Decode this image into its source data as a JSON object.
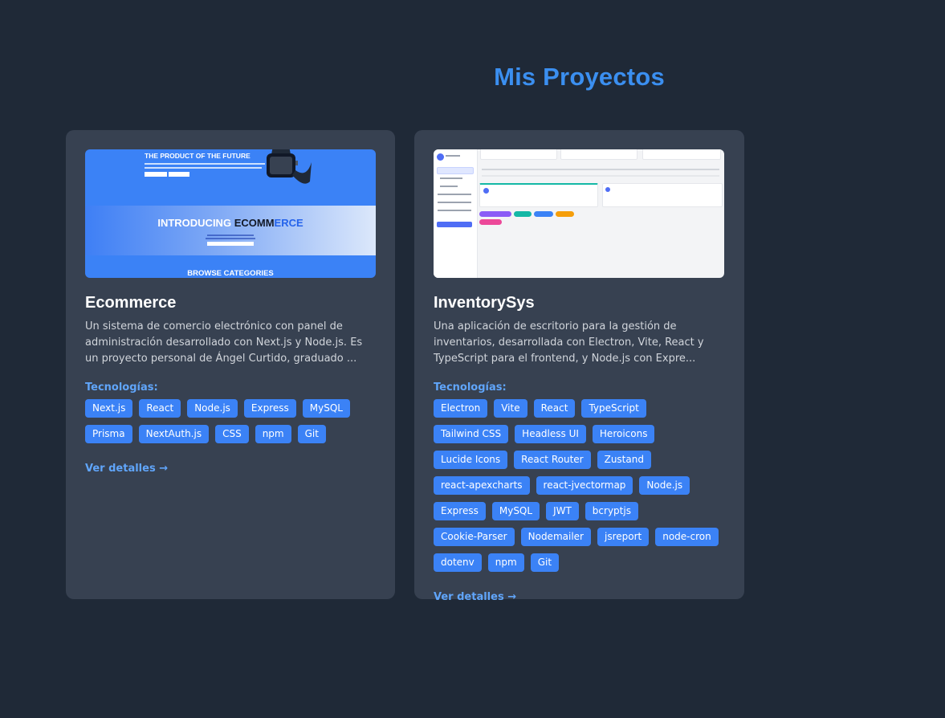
{
  "section_title": "Mis Proyectos",
  "colors": {
    "page_bg": "#1f2937",
    "card_bg": "#374151",
    "accent": "#3b82f6",
    "link": "#60a5fa"
  },
  "projects": [
    {
      "title": "Ecommerce",
      "description": "Un sistema de comercio electrónico con panel de administración desarrollado con Next.js y Node.js. Es un proyecto personal de Ángel Curtido, graduado ...",
      "tech_label": "Tecnologías:",
      "technologies": [
        "Next.js",
        "React",
        "Node.js",
        "Express",
        "MySQL",
        "Prisma",
        "NextAuth.js",
        "CSS",
        "npm",
        "Git"
      ],
      "details_label": "Ver detalles →",
      "thumbnail": {
        "hero_title": "THE PRODUCT OF THE FUTURE",
        "banner_a": "INTRODUCING ",
        "banner_b": "ECOMM",
        "banner_c": "ERCE",
        "bottom_title": "BROWSE CATEGORIES"
      }
    },
    {
      "title": "InventorySys",
      "description": "Una aplicación de escritorio para la gestión de inventarios, desarrollada con Electron, Vite, React y TypeScript para el frontend, y Node.js con Expre...",
      "tech_label": "Tecnologías:",
      "technologies": [
        "Electron",
        "Vite",
        "React",
        "TypeScript",
        "Tailwind CSS",
        "Headless UI",
        "Heroicons",
        "Lucide Icons",
        "React Router",
        "Zustand",
        "react-apexcharts",
        "react-jvectormap",
        "Node.js",
        "Express",
        "MySQL",
        "JWT",
        "bcryptjs",
        "Cookie-Parser",
        "Nodemailer",
        "jsreport",
        "node-cron",
        "dotenv",
        "npm",
        "Git"
      ],
      "details_label": "Ver detalles →"
    }
  ]
}
